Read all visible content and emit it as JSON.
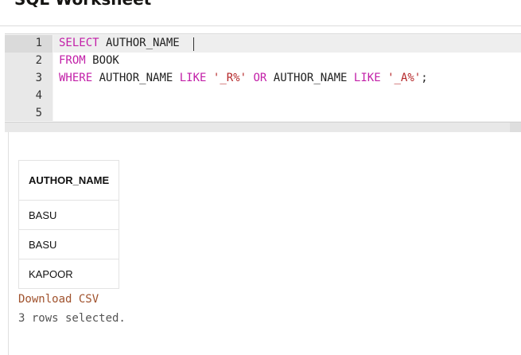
{
  "worksheet": {
    "title": "SQL Worksheet"
  },
  "editor": {
    "line_numbers": [
      "1",
      "2",
      "3",
      "4",
      "5"
    ],
    "lines": [
      [
        {
          "t": "SELECT",
          "k": "kw"
        },
        {
          "t": " AUTHOR_NAME",
          "k": "txt"
        }
      ],
      [
        {
          "t": "FROM",
          "k": "kw"
        },
        {
          "t": " BOOK",
          "k": "txt"
        }
      ],
      [
        {
          "t": "WHERE",
          "k": "kw"
        },
        {
          "t": " AUTHOR_NAME ",
          "k": "txt"
        },
        {
          "t": "LIKE",
          "k": "kw"
        },
        {
          "t": " ",
          "k": "txt"
        },
        {
          "t": "'_R%'",
          "k": "str"
        },
        {
          "t": " ",
          "k": "txt"
        },
        {
          "t": "OR",
          "k": "kw"
        },
        {
          "t": " AUTHOR_NAME ",
          "k": "txt"
        },
        {
          "t": "LIKE",
          "k": "kw"
        },
        {
          "t": " ",
          "k": "txt"
        },
        {
          "t": "'_A%'",
          "k": "str"
        },
        {
          "t": ";",
          "k": "txt"
        }
      ],
      [],
      []
    ]
  },
  "results": {
    "columns": [
      "AUTHOR_NAME"
    ],
    "rows": [
      [
        "BASU"
      ],
      [
        "BASU"
      ],
      [
        "KAPOOR"
      ]
    ],
    "download_label": "Download CSV",
    "row_count_text": "3 rows selected."
  },
  "colors": {
    "keyword": "#c21fa8",
    "string": "#b5282a",
    "link": "#a0522d"
  }
}
